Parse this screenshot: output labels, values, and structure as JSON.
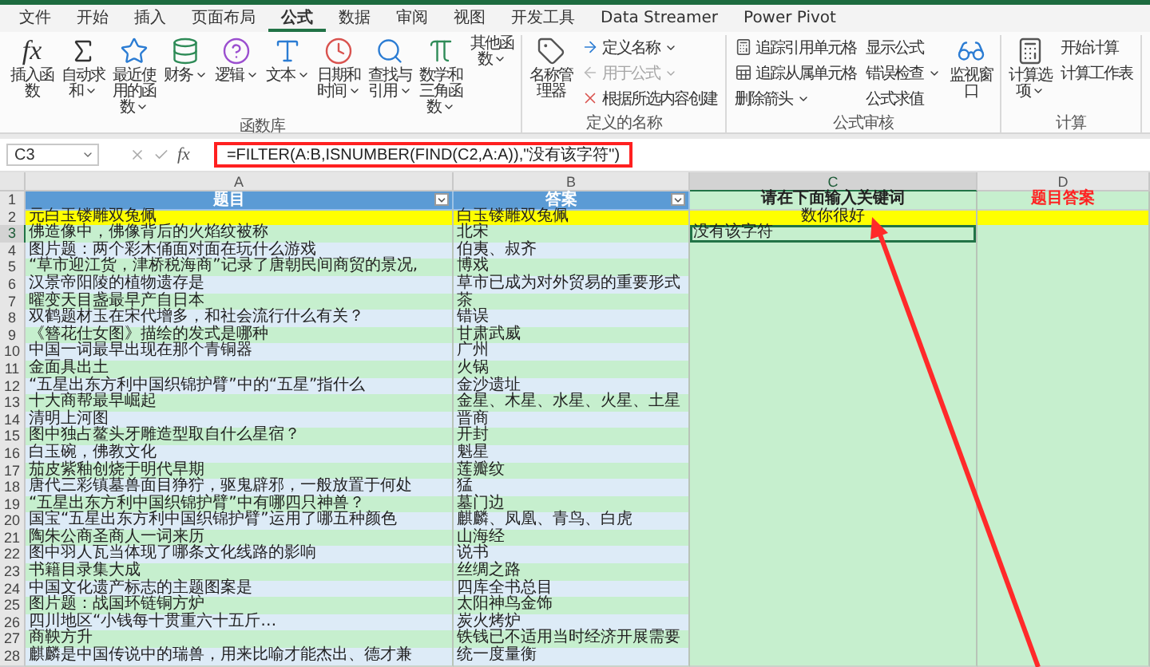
{
  "tabs": [
    {
      "label": "文件",
      "selected": false
    },
    {
      "label": "开始",
      "selected": false
    },
    {
      "label": "插入",
      "selected": false
    },
    {
      "label": "页面布局",
      "selected": false
    },
    {
      "label": "公式",
      "selected": true
    },
    {
      "label": "数据",
      "selected": false
    },
    {
      "label": "审阅",
      "selected": false
    },
    {
      "label": "视图",
      "selected": false
    },
    {
      "label": "开发工具",
      "selected": false
    },
    {
      "label": "Data Streamer",
      "selected": false
    },
    {
      "label": "Power Pivot",
      "selected": false
    }
  ],
  "ribbon": {
    "groups": [
      {
        "label": "函数库",
        "items": [
          {
            "kind": "large",
            "label": "插入函数",
            "glyph": "fx",
            "dropdown": false
          },
          {
            "kind": "large",
            "label": "自动求和",
            "dropdown": true
          },
          {
            "kind": "large",
            "label": "最近使用的函数",
            "dropdown": true
          },
          {
            "kind": "large",
            "label": "财务",
            "dropdown": true
          },
          {
            "kind": "large",
            "label": "逻辑",
            "dropdown": true
          },
          {
            "kind": "large",
            "label": "文本",
            "dropdown": true
          },
          {
            "kind": "large",
            "label": "日期和时间",
            "dropdown": true
          },
          {
            "kind": "large",
            "label": "查找与引用",
            "dropdown": true
          },
          {
            "kind": "large",
            "label": "数学和三角函数",
            "dropdown": true
          },
          {
            "kind": "large",
            "label": "其他函数",
            "dropdown": true
          }
        ]
      },
      {
        "label": "定义的名称",
        "items": [
          {
            "kind": "large",
            "label": "名称管理器",
            "dropdown": false
          },
          {
            "kind": "stack",
            "items": [
              {
                "label": "定义名称",
                "dropdown": true,
                "disabled": false
              },
              {
                "label": "用于公式",
                "dropdown": true,
                "disabled": true
              },
              {
                "label": "根据所选内容创建",
                "dropdown": false,
                "disabled": false
              }
            ]
          }
        ]
      },
      {
        "label": "公式审核",
        "items": [
          {
            "kind": "stack",
            "items": [
              {
                "label": "追踪引用单元格",
                "dropdown": false,
                "disabled": false
              },
              {
                "label": "追踪从属单元格",
                "dropdown": false,
                "disabled": false
              },
              {
                "label": "删除箭头",
                "dropdown": true,
                "disabled": false
              }
            ]
          },
          {
            "kind": "stack",
            "items": [
              {
                "label": "显示公式",
                "dropdown": false,
                "disabled": false
              },
              {
                "label": "错误检查",
                "dropdown": true,
                "disabled": false
              },
              {
                "label": "公式求值",
                "dropdown": false,
                "disabled": false
              }
            ]
          },
          {
            "kind": "large",
            "label": "监视窗口",
            "dropdown": false
          }
        ]
      },
      {
        "label": "计算",
        "items": [
          {
            "kind": "large",
            "label": "计算选项",
            "dropdown": true
          },
          {
            "kind": "stack",
            "items": [
              {
                "label": "开始计算",
                "dropdown": false,
                "disabled": false
              },
              {
                "label": "计算工作表",
                "dropdown": false,
                "disabled": false
              }
            ]
          }
        ]
      }
    ]
  },
  "formula_bar": {
    "name_box": "C3",
    "function_label": "fx",
    "formula": "=FILTER(A:B,ISNUMBER(FIND(C2,A:A)),\"没有该字符\")"
  },
  "sheet": {
    "columns": [
      {
        "letter": "A",
        "selected": false
      },
      {
        "letter": "B",
        "selected": false
      },
      {
        "letter": "C",
        "selected": true
      },
      {
        "letter": "D",
        "selected": false
      }
    ],
    "rows": [
      {
        "number": "1",
        "highlighted": false,
        "cells": [
          {
            "kind": "header",
            "text": "题目"
          },
          {
            "kind": "header",
            "text": "答案"
          },
          {
            "kind": "title",
            "text": "请在下面输入关键词"
          },
          {
            "kind": "accent",
            "text": "题目答案"
          }
        ]
      },
      {
        "number": "2",
        "highlighted": true,
        "cells": [
          {
            "text": "元白玉镂雕双兔佩",
            "selected": false
          },
          {
            "text": "白玉镂雕双兔佩",
            "selected": false
          },
          {
            "text": "数你很好",
            "selected": false
          },
          {
            "selected": false
          }
        ]
      },
      {
        "number": "3",
        "highlighted": false,
        "cells": [
          {
            "text": "佛造像中，佛像背后的火焰纹被称",
            "selected": false
          },
          {
            "text": "北宋",
            "selected": false
          },
          {
            "text": "没有该字符",
            "selected": true
          },
          {
            "selected": false
          }
        ]
      },
      {
        "number": "4",
        "highlighted": false,
        "cells": [
          {
            "text": "图片题：两个彩木俑面对面在玩什么游戏",
            "selected": false
          },
          {
            "text": "伯夷、叔齐",
            "selected": false
          },
          {
            "selected": false
          },
          {
            "selected": false
          }
        ]
      },
      {
        "number": "5",
        "highlighted": false,
        "cells": [
          {
            "text": "“草市迎江货，津桥税海商”记录了唐朝民间商贸的景况,",
            "selected": false
          },
          {
            "text": "博戏",
            "selected": false
          },
          {
            "selected": false
          },
          {
            "selected": false
          }
        ]
      },
      {
        "number": "6",
        "highlighted": false,
        "cells": [
          {
            "text": "汉景帝阳陵的植物遗存是",
            "selected": false
          },
          {
            "text": "草市已成为对外贸易的重要形式",
            "selected": false
          },
          {
            "selected": false
          },
          {
            "selected": false
          }
        ]
      },
      {
        "number": "7",
        "highlighted": false,
        "cells": [
          {
            "text": "曜变天目盏最早产自日本",
            "selected": false
          },
          {
            "text": "茶",
            "selected": false
          },
          {
            "selected": false
          },
          {
            "selected": false
          }
        ]
      },
      {
        "number": "8",
        "highlighted": false,
        "cells": [
          {
            "text": "双鹤题材玉在宋代增多，和社会流行什么有关？",
            "selected": false
          },
          {
            "text": "错误",
            "selected": false
          },
          {
            "selected": false
          },
          {
            "selected": false
          }
        ]
      },
      {
        "number": "9",
        "highlighted": false,
        "cells": [
          {
            "text": "《簪花仕女图》描绘的发式是哪种",
            "selected": false
          },
          {
            "text": "甘肃武威",
            "selected": false
          },
          {
            "selected": false
          },
          {
            "selected": false
          }
        ]
      },
      {
        "number": "10",
        "highlighted": false,
        "cells": [
          {
            "text": "中国一词最早出现在那个青铜器",
            "selected": false
          },
          {
            "text": "广州",
            "selected": false
          },
          {
            "selected": false
          },
          {
            "selected": false
          }
        ]
      },
      {
        "number": "11",
        "highlighted": false,
        "cells": [
          {
            "text": "金面具出土",
            "selected": false
          },
          {
            "text": "火锅",
            "selected": false
          },
          {
            "selected": false
          },
          {
            "selected": false
          }
        ]
      },
      {
        "number": "12",
        "highlighted": false,
        "cells": [
          {
            "text": "“五星出东方利中国织锦护臂”中的“五星”指什么",
            "selected": false
          },
          {
            "text": "金沙遗址",
            "selected": false
          },
          {
            "selected": false
          },
          {
            "selected": false
          }
        ]
      },
      {
        "number": "13",
        "highlighted": false,
        "cells": [
          {
            "text": "十大商帮最早崛起",
            "selected": false
          },
          {
            "text": "金星、木星、水星、火星、土星",
            "selected": false
          },
          {
            "selected": false
          },
          {
            "selected": false
          }
        ]
      },
      {
        "number": "14",
        "highlighted": false,
        "cells": [
          {
            "text": "清明上河图",
            "selected": false
          },
          {
            "text": "晋商",
            "selected": false
          },
          {
            "selected": false
          },
          {
            "selected": false
          }
        ]
      },
      {
        "number": "15",
        "highlighted": false,
        "cells": [
          {
            "text": "图中独占鳌头牙雕造型取自什么星宿？",
            "selected": false
          },
          {
            "text": "开封",
            "selected": false
          },
          {
            "selected": false
          },
          {
            "selected": false
          }
        ]
      },
      {
        "number": "16",
        "highlighted": false,
        "cells": [
          {
            "text": "白玉碗，佛教文化",
            "selected": false
          },
          {
            "text": "魁星",
            "selected": false
          },
          {
            "selected": false
          },
          {
            "selected": false
          }
        ]
      },
      {
        "number": "17",
        "highlighted": false,
        "cells": [
          {
            "text": "茄皮紫釉创烧于明代早期",
            "selected": false
          },
          {
            "text": "莲瓣纹",
            "selected": false
          },
          {
            "selected": false
          },
          {
            "selected": false
          }
        ]
      },
      {
        "number": "18",
        "highlighted": false,
        "cells": [
          {
            "text": "唐代三彩镇墓兽面目狰狞，驱鬼辟邪，一般放置于何处",
            "selected": false
          },
          {
            "text": "猛",
            "selected": false
          },
          {
            "selected": false
          },
          {
            "selected": false
          }
        ]
      },
      {
        "number": "19",
        "highlighted": false,
        "cells": [
          {
            "text": "“五星出东方利中国织锦护臂”中有哪四只神兽？",
            "selected": false
          },
          {
            "text": "墓门边",
            "selected": false
          },
          {
            "selected": false
          },
          {
            "selected": false
          }
        ]
      },
      {
        "number": "20",
        "highlighted": false,
        "cells": [
          {
            "text": "国宝“五星出东方利中国织锦护臂”运用了哪五种颜色",
            "selected": false
          },
          {
            "text": "麒麟、凤凰、青鸟、白虎",
            "selected": false
          },
          {
            "selected": false
          },
          {
            "selected": false
          }
        ]
      },
      {
        "number": "21",
        "highlighted": false,
        "cells": [
          {
            "text": "陶朱公商圣商人一词来历",
            "selected": false
          },
          {
            "text": "山海经",
            "selected": false
          },
          {
            "selected": false
          },
          {
            "selected": false
          }
        ]
      },
      {
        "number": "22",
        "highlighted": false,
        "cells": [
          {
            "text": "图中羽人瓦当体现了哪条文化线路的影响",
            "selected": false
          },
          {
            "text": "说书",
            "selected": false
          },
          {
            "selected": false
          },
          {
            "selected": false
          }
        ]
      },
      {
        "number": "23",
        "highlighted": false,
        "cells": [
          {
            "text": "书籍目录集大成",
            "selected": false
          },
          {
            "text": "丝绸之路",
            "selected": false
          },
          {
            "selected": false
          },
          {
            "selected": false
          }
        ]
      },
      {
        "number": "24",
        "highlighted": false,
        "cells": [
          {
            "text": "中国文化遗产标志的主题图案是",
            "selected": false
          },
          {
            "text": "四库全书总目",
            "selected": false
          },
          {
            "selected": false
          },
          {
            "selected": false
          }
        ]
      },
      {
        "number": "25",
        "highlighted": false,
        "cells": [
          {
            "text": "图片题：战国环链铜方炉",
            "selected": false
          },
          {
            "text": "太阳神鸟金饰",
            "selected": false
          },
          {
            "selected": false
          },
          {
            "selected": false
          }
        ]
      },
      {
        "number": "26",
        "highlighted": false,
        "cells": [
          {
            "text": "四川地区“小钱每十贯重六十五斤…",
            "selected": false
          },
          {
            "text": "炭火烤炉",
            "selected": false
          },
          {
            "selected": false
          },
          {
            "selected": false
          }
        ]
      },
      {
        "number": "27",
        "highlighted": false,
        "cells": [
          {
            "text": "商鞅方升",
            "selected": false
          },
          {
            "text": "铁钱已不适用当时经济开展需要",
            "selected": false
          },
          {
            "selected": false
          },
          {
            "selected": false
          }
        ]
      },
      {
        "number": "28",
        "highlighted": false,
        "cells": [
          {
            "text": "麒麟是中国传说中的瑞兽，用来比喻才能杰出、德才兼",
            "selected": false
          },
          {
            "text": "统一度量衡",
            "selected": false
          },
          {
            "selected": false
          },
          {
            "selected": false
          }
        ]
      }
    ]
  }
}
